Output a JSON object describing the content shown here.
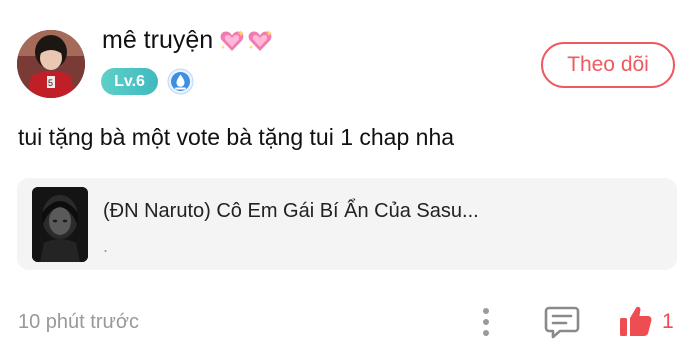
{
  "comment": {
    "user": {
      "name": "mê truyện",
      "level": "Lv.6"
    },
    "follow_label": "Theo dõi",
    "text": "tui tặng bà một vote bà tặng tui 1 chap nha",
    "story": {
      "title": "(ĐN Naruto) Cô Em Gái Bí Ẩn Của Sasu...",
      "subtitle": "."
    },
    "timestamp": "10 phút trước",
    "likes": "1"
  },
  "colors": {
    "accent": "#ee5a5f",
    "like": "#ee4d52",
    "level_badge": "#4fc4c4",
    "card_bg": "#f4f4f5",
    "muted_text": "#999999"
  },
  "icons": {
    "hearts": "sparkling-heart-icon",
    "water": "water-drop-badge-icon",
    "more": "more-vertical-icon",
    "comment": "comment-icon",
    "like": "thumbs-up-icon"
  }
}
